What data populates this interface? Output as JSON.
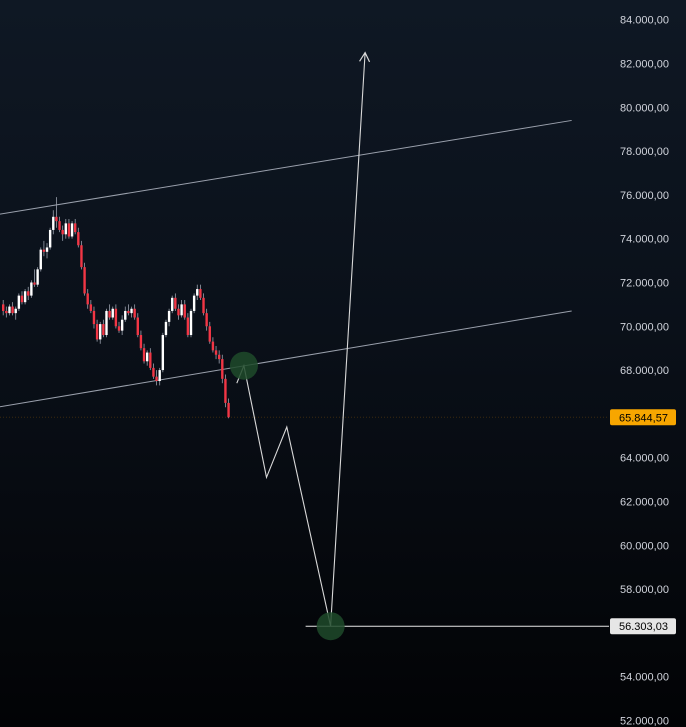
{
  "chart_data": {
    "type": "candlestick",
    "title": "",
    "xlabel": "",
    "ylabel": "",
    "ylim": [
      51700,
      84900
    ],
    "y_ticks": [
      {
        "value": 84000,
        "label": "84.000,00"
      },
      {
        "value": 82000,
        "label": "82.000,00"
      },
      {
        "value": 80000,
        "label": "80.000,00"
      },
      {
        "value": 78000,
        "label": "78.000,00"
      },
      {
        "value": 76000,
        "label": "76.000,00"
      },
      {
        "value": 74000,
        "label": "74.000,00"
      },
      {
        "value": 72000,
        "label": "72.000,00"
      },
      {
        "value": 70000,
        "label": "70.000,00"
      },
      {
        "value": 68000,
        "label": "68.000,00"
      },
      {
        "value": 64000,
        "label": "64.000,00"
      },
      {
        "value": 62000,
        "label": "62.000,00"
      },
      {
        "value": 60000,
        "label": "60.000,00"
      },
      {
        "value": 58000,
        "label": "58.000,00"
      },
      {
        "value": 54000,
        "label": "54.000,00"
      },
      {
        "value": 52000,
        "label": "52.000,00"
      }
    ],
    "x_bars": 105,
    "candles": [
      [
        0,
        71000,
        71200,
        70500,
        70700
      ],
      [
        1,
        70700,
        70900,
        70400,
        70600
      ],
      [
        2,
        70600,
        71000,
        70500,
        70900
      ],
      [
        3,
        70900,
        71100,
        70500,
        70600
      ],
      [
        4,
        70600,
        70900,
        70300,
        70800
      ],
      [
        5,
        70800,
        71500,
        70700,
        71400
      ],
      [
        6,
        71400,
        71600,
        71000,
        71100
      ],
      [
        7,
        71100,
        71700,
        71000,
        71600
      ],
      [
        8,
        71600,
        71800,
        71200,
        71400
      ],
      [
        9,
        71400,
        72100,
        71300,
        72000
      ],
      [
        10,
        72000,
        72600,
        71800,
        71900
      ],
      [
        11,
        71900,
        72700,
        71800,
        72600
      ],
      [
        12,
        72600,
        73600,
        72500,
        73500
      ],
      [
        13,
        73500,
        73900,
        73200,
        73400
      ],
      [
        14,
        73400,
        73800,
        73100,
        73600
      ],
      [
        15,
        73600,
        74500,
        73500,
        74400
      ],
      [
        16,
        74400,
        75300,
        74200,
        75000
      ],
      [
        17,
        75000,
        75900,
        74500,
        74800
      ],
      [
        18,
        74800,
        75000,
        74300,
        74400
      ],
      [
        19,
        74400,
        74600,
        73900,
        74200
      ],
      [
        20,
        74200,
        74900,
        74000,
        74700
      ],
      [
        21,
        74700,
        74900,
        74000,
        74100
      ],
      [
        22,
        74100,
        74800,
        74000,
        74700
      ],
      [
        23,
        74700,
        74900,
        74200,
        74300
      ],
      [
        24,
        74300,
        74500,
        73600,
        73700
      ],
      [
        25,
        73700,
        73900,
        72600,
        72700
      ],
      [
        26,
        72700,
        72900,
        71400,
        71500
      ],
      [
        27,
        71500,
        71700,
        70800,
        71000
      ],
      [
        28,
        71000,
        71200,
        70600,
        70700
      ],
      [
        29,
        70700,
        70900,
        69900,
        70100
      ],
      [
        30,
        70100,
        70300,
        69300,
        69400
      ],
      [
        31,
        69400,
        70200,
        69200,
        70100
      ],
      [
        32,
        70100,
        70300,
        69500,
        69600
      ],
      [
        33,
        69600,
        70800,
        69500,
        70700
      ],
      [
        34,
        70700,
        71000,
        70300,
        70400
      ],
      [
        35,
        70400,
        70900,
        70300,
        70800
      ],
      [
        36,
        70800,
        71000,
        69900,
        70000
      ],
      [
        37,
        70000,
        70200,
        69700,
        69800
      ],
      [
        38,
        69800,
        70500,
        69600,
        70300
      ],
      [
        39,
        70300,
        70900,
        70200,
        70700
      ],
      [
        40,
        70700,
        71000,
        70500,
        70600
      ],
      [
        41,
        70600,
        70900,
        70400,
        70800
      ],
      [
        42,
        70800,
        71000,
        70300,
        70400
      ],
      [
        43,
        70400,
        70600,
        69500,
        69600
      ],
      [
        44,
        69600,
        69800,
        68900,
        69000
      ],
      [
        45,
        69000,
        69200,
        68300,
        68400
      ],
      [
        46,
        68400,
        68900,
        68200,
        68800
      ],
      [
        47,
        68800,
        69000,
        68000,
        68100
      ],
      [
        48,
        68100,
        68300,
        67600,
        67700
      ],
      [
        49,
        67700,
        68000,
        67300,
        67500
      ],
      [
        50,
        67500,
        68100,
        67300,
        68000
      ],
      [
        51,
        68000,
        69700,
        67900,
        69600
      ],
      [
        52,
        69600,
        70300,
        69500,
        70200
      ],
      [
        53,
        70200,
        70800,
        70000,
        70700
      ],
      [
        54,
        70700,
        71400,
        70600,
        71300
      ],
      [
        55,
        71300,
        71500,
        70700,
        70800
      ],
      [
        56,
        70800,
        71000,
        70300,
        70500
      ],
      [
        57,
        70500,
        71200,
        70400,
        71000
      ],
      [
        58,
        71000,
        71200,
        70300,
        70400
      ],
      [
        59,
        70400,
        70600,
        69500,
        69600
      ],
      [
        60,
        69600,
        70800,
        69500,
        70700
      ],
      [
        61,
        70700,
        71500,
        70600,
        71400
      ],
      [
        62,
        71400,
        71900,
        71200,
        71700
      ],
      [
        63,
        71700,
        71900,
        71200,
        71300
      ],
      [
        64,
        71300,
        71500,
        70500,
        70600
      ],
      [
        65,
        70600,
        70800,
        69800,
        70000
      ],
      [
        66,
        70000,
        70200,
        69200,
        69300
      ],
      [
        67,
        69300,
        69500,
        68800,
        68900
      ],
      [
        68,
        68900,
        69100,
        68500,
        68700
      ],
      [
        69,
        68700,
        68900,
        68300,
        68500
      ],
      [
        70,
        68500,
        68700,
        67400,
        67600
      ],
      [
        71,
        67600,
        67800,
        66300,
        66500
      ],
      [
        72,
        66500,
        66700,
        65800,
        65845
      ]
    ],
    "channel_upper": [
      [
        -10,
        74900
      ],
      [
        182,
        79400
      ]
    ],
    "channel_lower": [
      [
        -10,
        66100
      ],
      [
        182,
        70700
      ]
    ],
    "projection_path": [
      [
        75,
        67400
      ],
      [
        77.3,
        68200
      ],
      [
        84.5,
        63100
      ],
      [
        91,
        65400
      ],
      [
        105,
        56303
      ],
      [
        116,
        82500
      ]
    ],
    "markers": [
      {
        "x": 77.3,
        "y": 68200,
        "color": "#1f4a2a"
      },
      {
        "x": 105,
        "y": 56303,
        "color": "#1f4a2a"
      }
    ],
    "target_line": {
      "value": 56303,
      "x_start": 97
    },
    "current_price_line": {
      "value": 65845
    },
    "badges": [
      {
        "label": "65.844,57",
        "value": 65845,
        "bg": "#f7a600",
        "fg": "#000000"
      },
      {
        "label": "56.303,03",
        "value": 56303,
        "bg": "#e6e6e6",
        "fg": "#000000"
      }
    ],
    "colors": {
      "up": "#ffffff",
      "down": "#f23645",
      "wick": "#9aa0ac",
      "channel": "#9aa0ac",
      "projection": "#d9d9d9",
      "tick_text": "#d1d4dc"
    }
  }
}
